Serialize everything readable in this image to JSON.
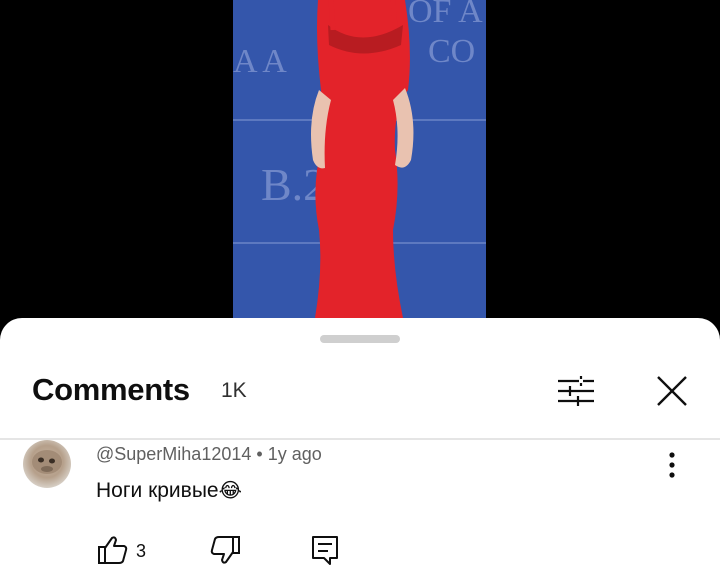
{
  "video": {
    "backdrop_text_top": "OF A",
    "backdrop_text_mid": "CO",
    "backdrop_text_left": "A  A",
    "backdrop_logo": "B.2  01"
  },
  "comments_panel": {
    "title": "Comments",
    "count": "1K"
  },
  "comment": {
    "author": "@SuperMiha12014",
    "separator": "•",
    "time": "1y ago",
    "text": "Ноги кривые",
    "emoji": "😂",
    "like_count": "3"
  },
  "colors": {
    "sheet_background": "#ffffff",
    "text_primary": "#0f0f0f",
    "text_secondary": "#606060",
    "video_backdrop": "#3557ad",
    "dress_red": "#e3232a"
  },
  "icons": {
    "filter": "sliders-icon",
    "close": "close-icon",
    "more": "vertical-dots-icon",
    "like": "thumb-up-icon",
    "dislike": "thumb-down-icon",
    "reply": "reply-icon"
  }
}
